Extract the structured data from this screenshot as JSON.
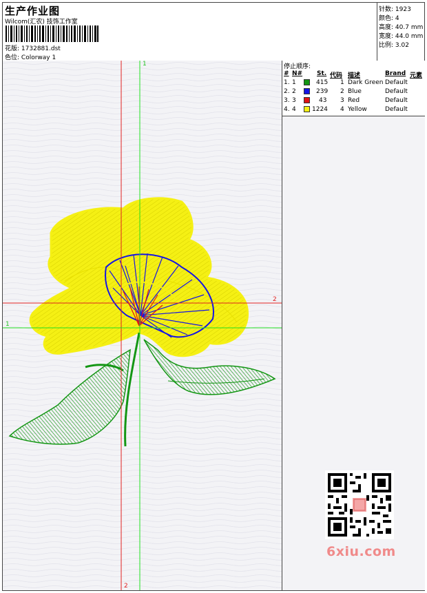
{
  "header": {
    "title": "生产作业图",
    "company": "Wilcom(汇农) 技饰工作室",
    "design_label": "花版:",
    "design_file": "1732881.dst",
    "color_label": "色位:",
    "colorway": "Colorway 1"
  },
  "stats": {
    "stitches_label": "针数:",
    "stitches": "1923",
    "colors_label": "颜色:",
    "colors": "4",
    "height_label": "高度:",
    "height": "40.7 mm",
    "width_label": "宽度:",
    "width": "44.0 mm",
    "scale_label": "比例:",
    "scale": "3.02"
  },
  "stop_sequence": {
    "title": "停止顺序:",
    "headers": {
      "num": "#",
      "n": "N#",
      "st": "St.",
      "code": "代码",
      "desc": "描述",
      "brand": "Brand",
      "elem": "元素"
    },
    "rows": [
      {
        "num": "1.",
        "n": "1",
        "st": "415",
        "code": "1",
        "desc": "Dark Green",
        "brand": "Default",
        "color": "#149614"
      },
      {
        "num": "2.",
        "n": "2",
        "st": "239",
        "code": "2",
        "desc": "Blue",
        "brand": "Default",
        "color": "#1414e6"
      },
      {
        "num": "3.",
        "n": "3",
        "st": "43",
        "code": "3",
        "desc": "Red",
        "brand": "Default",
        "color": "#e01414"
      },
      {
        "num": "4.",
        "n": "4",
        "st": "1224",
        "code": "4",
        "desc": "Yellow",
        "brand": "Default",
        "color": "#f5f014"
      }
    ]
  },
  "axes": {
    "green_v": "1",
    "green_h": "1",
    "red_h": "2",
    "red_v": "2"
  },
  "watermark": "6xiu.com",
  "colors": {
    "yellow": "#f5f014",
    "blue": "#1414e6",
    "red": "#e01414",
    "green": "#149614",
    "guide_red": "#e02020",
    "guide_green": "#20e020"
  }
}
